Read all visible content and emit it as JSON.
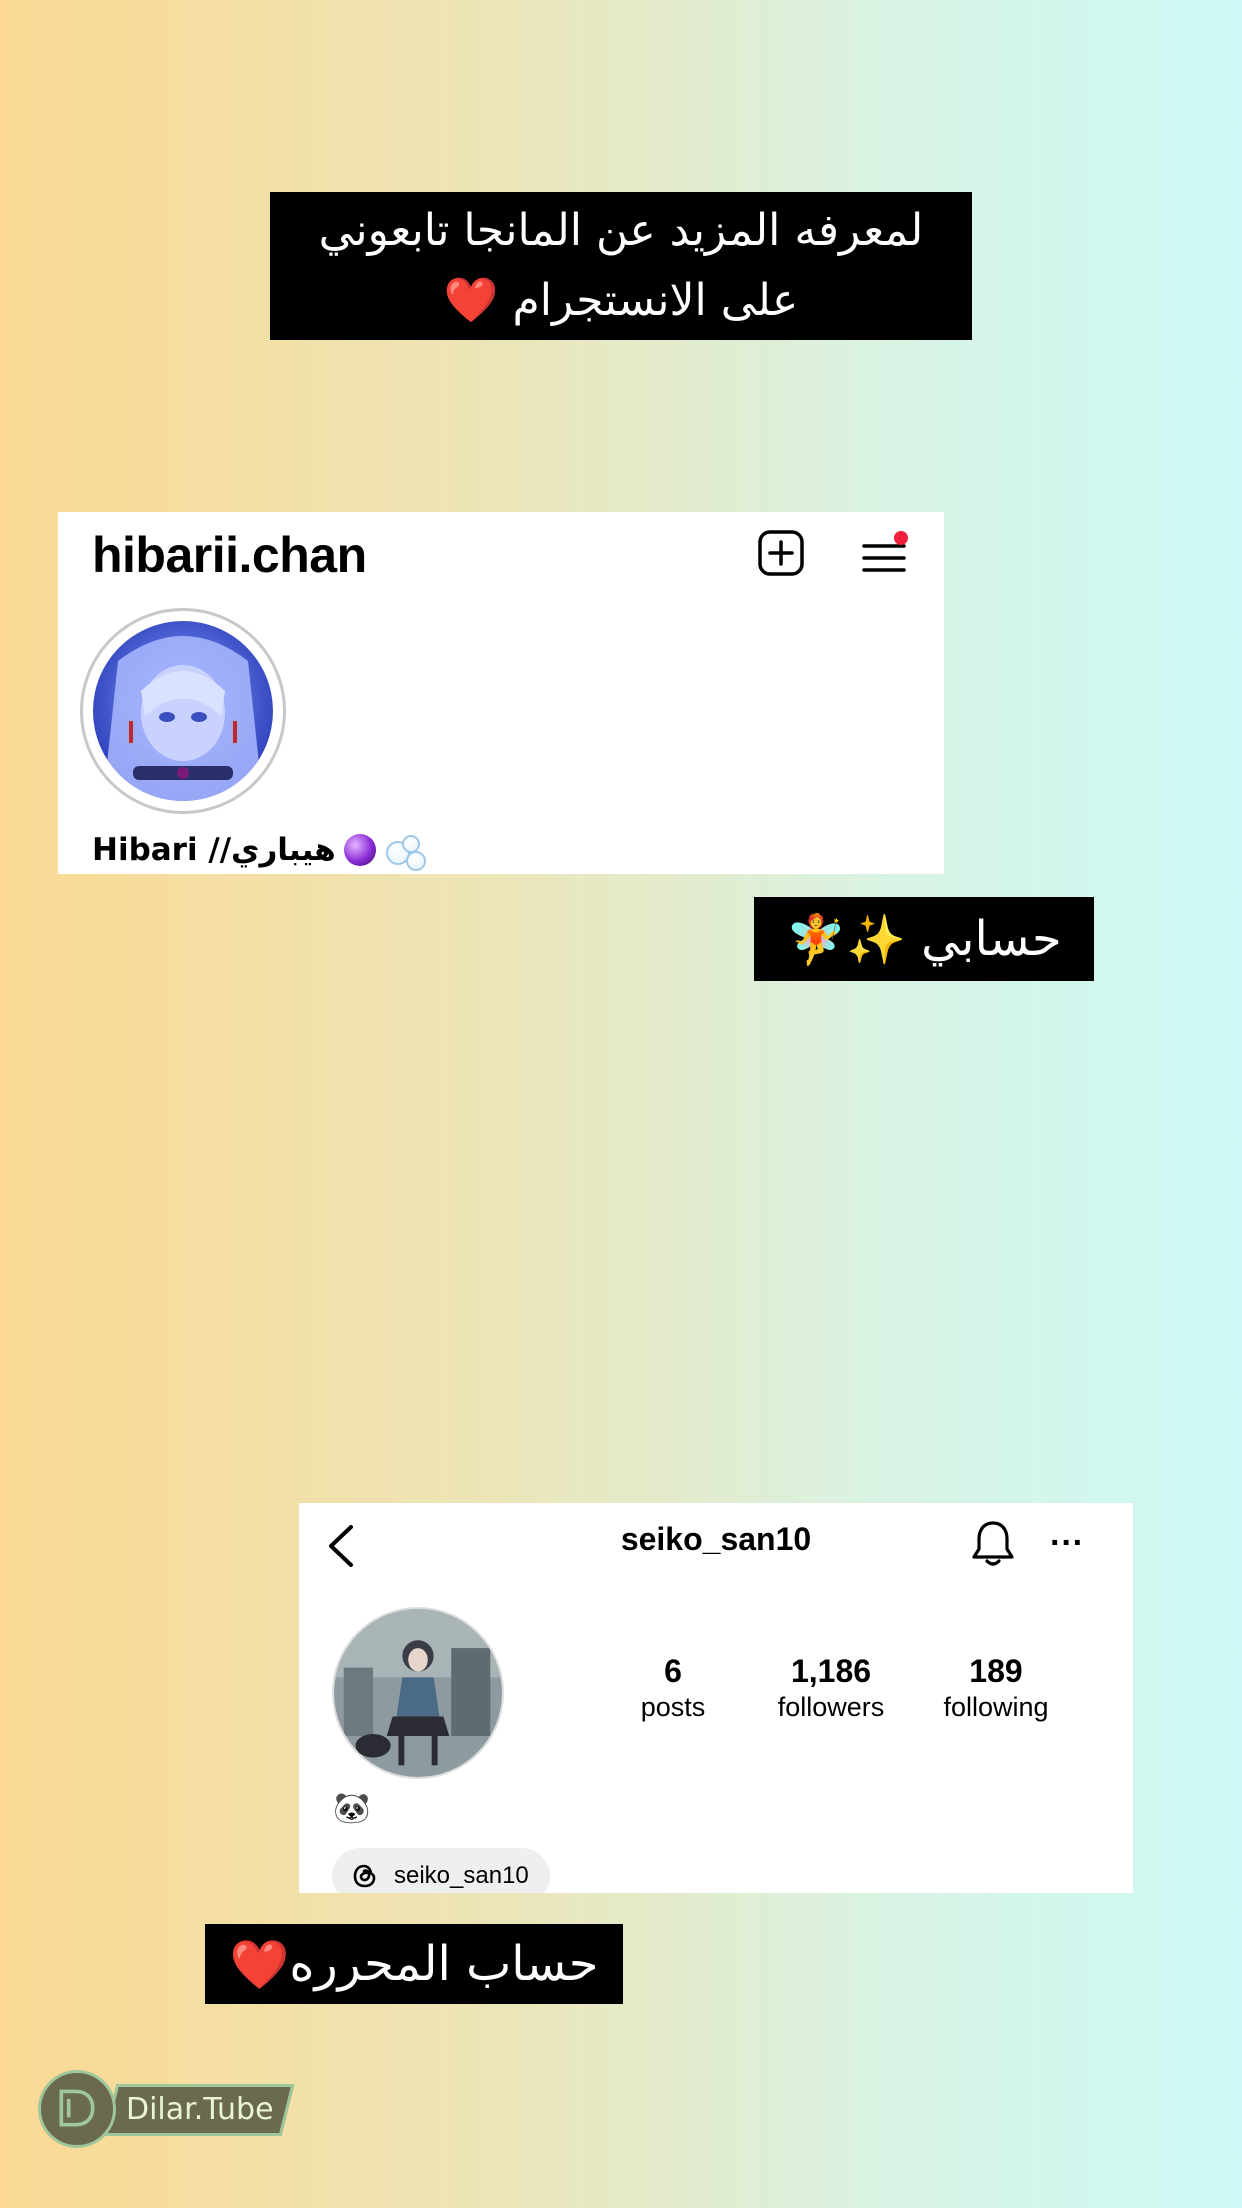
{
  "banners": {
    "top_line1": "لمعرفه المزيد عن المانجا تابعوني",
    "top_line2": "على الانستجرام",
    "heart": "❤️",
    "mine_text": "حسابي",
    "mine_emoji": "✨🧚",
    "editor_text": "حساب المحرره"
  },
  "hibari_profile": {
    "username": "hibarii.chan",
    "display_name": "Hibari //هيباري",
    "icons": [
      "add-post-icon",
      "menu-icon",
      "notification-dot",
      "crystal-ball-icon",
      "bubbles-icon"
    ],
    "notification_color": "#f0203c"
  },
  "seiko_profile": {
    "username": "seiko_san10",
    "stats": {
      "posts": {
        "value": "6",
        "label": "posts"
      },
      "followers": {
        "value": "1,186",
        "label": "followers"
      },
      "following": {
        "value": "189",
        "label": "following"
      }
    },
    "bio_emoji": "🐼",
    "threads_handle": "seiko_san10",
    "icons": [
      "back-arrow-icon",
      "bell-icon",
      "more-icon",
      "threads-icon"
    ]
  },
  "watermark": {
    "text": "Dilar.Tube"
  },
  "colors": {
    "banner_bg": "#000000",
    "heart": "#e8102e",
    "gradient_left": "#fbd993",
    "gradient_right": "#cdfaf6"
  }
}
